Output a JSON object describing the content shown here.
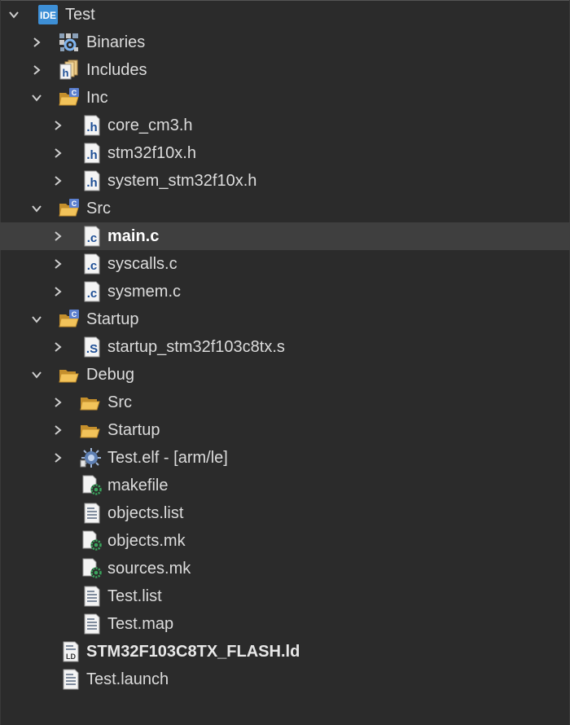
{
  "project": {
    "badge": "IDE",
    "name": "Test",
    "children": [
      {
        "label": "Binaries",
        "icon": "binaries-icon"
      },
      {
        "label": "Includes",
        "icon": "includes-icon"
      },
      {
        "label": "Inc",
        "icon": "source-folder-icon",
        "files": [
          "core_cm3.h",
          "stm32f10x.h",
          "system_stm32f10x.h"
        ]
      },
      {
        "label": "Src",
        "icon": "source-folder-icon",
        "files": [
          "main.c",
          "syscalls.c",
          "sysmem.c"
        ]
      },
      {
        "label": "Startup",
        "icon": "source-folder-icon",
        "files": [
          "startup_stm32f103c8tx.s"
        ]
      },
      {
        "label": "Debug",
        "icon": "folder-icon",
        "items": [
          "Src",
          "Startup",
          "Test.elf - [arm/le]",
          "makefile",
          "objects.list",
          "objects.mk",
          "sources.mk",
          "Test.list",
          "Test.map"
        ]
      },
      {
        "label": "STM32F103C8TX_FLASH.ld",
        "icon": "linker-script-icon"
      },
      {
        "label": "Test.launch",
        "icon": "text-file-icon"
      }
    ]
  },
  "selected": "main.c",
  "colors": {
    "background": "#2b2b2b",
    "selection": "#3f3f3f",
    "text": "#dcdcdc",
    "ide_badge": "#3d8fd6",
    "folder": "#e8b84e",
    "c_badge": "#5b7fcf",
    "makefile_gear": "#3aa55c"
  },
  "icons": {
    "ide": "ide-badge-icon",
    "binaries": "binaries-icon",
    "includes": "includes-icon",
    "source_folder": "source-folder-icon",
    "folder": "folder-icon",
    "h_file": "h-file-icon",
    "c_file": "c-file-icon",
    "s_file": "asm-file-icon",
    "elf": "elf-binary-icon",
    "makefile": "makefile-icon",
    "text_file": "text-file-icon",
    "linker": "linker-script-icon"
  }
}
